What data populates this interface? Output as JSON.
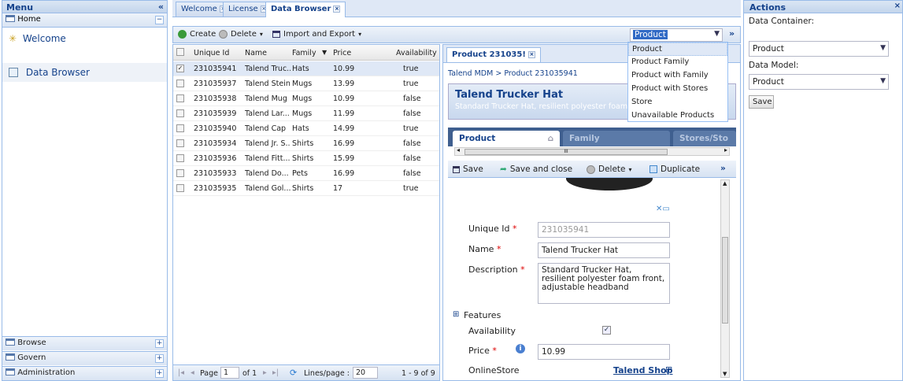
{
  "menu": {
    "title": "Menu",
    "collapse": "«",
    "home": "Home",
    "items": [
      "Welcome",
      "Data Browser"
    ],
    "bottom": [
      "Browse",
      "Govern",
      "Administration"
    ]
  },
  "tabs": [
    {
      "label": "Welcome"
    },
    {
      "label": "License"
    },
    {
      "label": "Data Browser"
    }
  ],
  "toolbar": {
    "create": "Create",
    "delete": "Delete",
    "import_export": "Import and Export",
    "entity_select": "Product",
    "expand": "»"
  },
  "entity_dropdown": {
    "options": [
      "Product",
      "Product Family",
      "Product with Family",
      "Product with Stores",
      "Store",
      "Unavailable Products"
    ]
  },
  "grid": {
    "columns": [
      "Unique Id",
      "Name",
      "Family",
      "Price",
      "Availability"
    ],
    "rows": [
      {
        "id": "231035941",
        "name": "Talend Truc...",
        "family": "Hats",
        "price": "10.99",
        "avail": "true"
      },
      {
        "id": "231035937",
        "name": "Talend Stein",
        "family": "Mugs",
        "price": "13.99",
        "avail": "true"
      },
      {
        "id": "231035938",
        "name": "Talend Mug",
        "family": "Mugs",
        "price": "10.99",
        "avail": "false"
      },
      {
        "id": "231035939",
        "name": "Talend Lar...",
        "family": "Mugs",
        "price": "11.99",
        "avail": "false"
      },
      {
        "id": "231035940",
        "name": "Talend Cap",
        "family": "Hats",
        "price": "14.99",
        "avail": "true"
      },
      {
        "id": "231035934",
        "name": "Talend Jr. S...",
        "family": "Shirts",
        "price": "16.99",
        "avail": "false"
      },
      {
        "id": "231035936",
        "name": "Talend Fitt...",
        "family": "Shirts",
        "price": "15.99",
        "avail": "false"
      },
      {
        "id": "231035933",
        "name": "Talend Do...",
        "family": "Pets",
        "price": "16.99",
        "avail": "false"
      },
      {
        "id": "231035935",
        "name": "Talend Gol...",
        "family": "Shirts",
        "price": "17",
        "avail": "true"
      }
    ],
    "pager": {
      "page_label": "Page",
      "page": "1",
      "of": "of 1",
      "lines_label": "Lines/page :",
      "lines": "20",
      "count": "1 - 9 of 9"
    }
  },
  "detail": {
    "tab": "Product 231035!",
    "breadcrumb": "Talend MDM > Product 231035941",
    "title": "Talend Trucker Hat",
    "subtitle": "Standard Trucker Hat, resilient polyester foam",
    "subtabs": [
      "Product",
      "Family",
      "Stores/Sto"
    ],
    "scroll_mid": "III",
    "save": "Save",
    "save_close": "Save and close",
    "delete": "Delete",
    "duplicate": "Duplicate",
    "more": "»",
    "fields": {
      "unique_id_label": "Unique Id",
      "unique_id": "231035941",
      "name_label": "Name",
      "name": "Talend Trucker Hat",
      "desc_label": "Description",
      "desc": "Standard Trucker Hat, resilient polyester foam front, adjustable headband",
      "features": "Features",
      "availability_label": "Availability",
      "price_label": "Price",
      "price": "10.99",
      "store_label": "OnlineStore",
      "store_link": "Talend Shop"
    }
  },
  "actions": {
    "title": "Actions",
    "container_label": "Data Container:",
    "container": "Product",
    "model_label": "Data Model:",
    "model": "Product",
    "save": "Save"
  }
}
